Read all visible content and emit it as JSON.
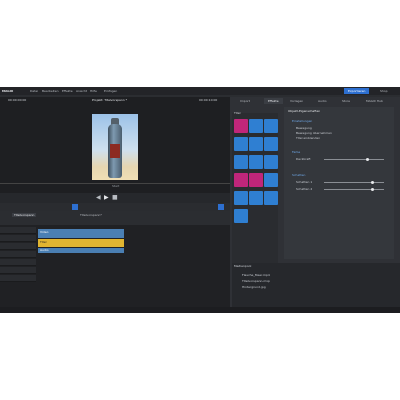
{
  "app": {
    "logo": "MAGIX",
    "project_title": "Projekt: Titelvorspann *"
  },
  "menu": [
    "Datei",
    "Bearbeiten",
    "Effekte",
    "Ansicht",
    "Hilfe",
    "Einfügen"
  ],
  "toolbar_right": {
    "export_label": "Exportieren",
    "shop_label": "Shop"
  },
  "preview": {
    "time_left": "00:00:00:00",
    "time_right": "00:00:10:00",
    "scrub_label": "Start"
  },
  "right_tabs": [
    "Import",
    "Effekte",
    "Vorlagen",
    "Audio",
    "Store",
    "MAGIX Hub"
  ],
  "effects": {
    "group_label": "Titel",
    "tiles": [
      {
        "icon": "title-T-icon",
        "color": "#c0267a"
      },
      {
        "icon": "globe-icon",
        "color": "#2f7fd2"
      },
      {
        "icon": "text-effect-icon",
        "color": "#2f7fd2"
      },
      {
        "icon": "image-icon",
        "color": "#2f7fd2"
      },
      {
        "icon": "frame-icon",
        "color": "#2f7fd2"
      },
      {
        "icon": "camera-icon",
        "color": "#2f7fd2"
      },
      {
        "icon": "crop-icon",
        "color": "#2f7fd2"
      },
      {
        "icon": "arrow-icon",
        "color": "#2f7fd2"
      },
      {
        "icon": "star-icon",
        "color": "#2f7fd2"
      },
      {
        "icon": "transform-icon",
        "color": "#c0267a"
      },
      {
        "icon": "move-icon",
        "color": "#c0267a"
      },
      {
        "icon": "pip-icon",
        "color": "#2f7fd2"
      },
      {
        "icon": "rotate-icon",
        "color": "#2f7fd2"
      },
      {
        "icon": "shape-icon",
        "color": "#2f7fd2"
      },
      {
        "icon": "zoom-icon",
        "color": "#2f7fd2"
      },
      {
        "icon": "blur-icon",
        "color": "#2f7fd2"
      }
    ]
  },
  "settings": {
    "header": "Objekt-Eigenschaften",
    "section1_title": "Einstellungen",
    "option1": "Bewegung",
    "option2": "Bewegung übernehmen",
    "option3": "Titel einblenden",
    "section2_title": "Farbe",
    "slider1_label": "Deckkraft",
    "slider1_value": 0.72,
    "section3_title": "Schatten",
    "slider2_label": "Schatten 1",
    "slider2_value": 0.8,
    "slider3_label": "Schatten 2",
    "slider3_value": 0.8
  },
  "timeline": {
    "tabs": [
      "Titelvorspann",
      "Titelvorspann*"
    ],
    "clips": [
      {
        "label": "Video",
        "color": "#4a7fb3"
      },
      {
        "label": "Titel",
        "color": "#e0b531"
      },
      {
        "label": "Audio",
        "color": "#4a7fb3"
      }
    ]
  },
  "bin": {
    "title": "Medienpool",
    "files": [
      "Flasche_Meer.mp4",
      "Titelvorspann.mxp",
      "Hintergrund.jpg"
    ]
  }
}
